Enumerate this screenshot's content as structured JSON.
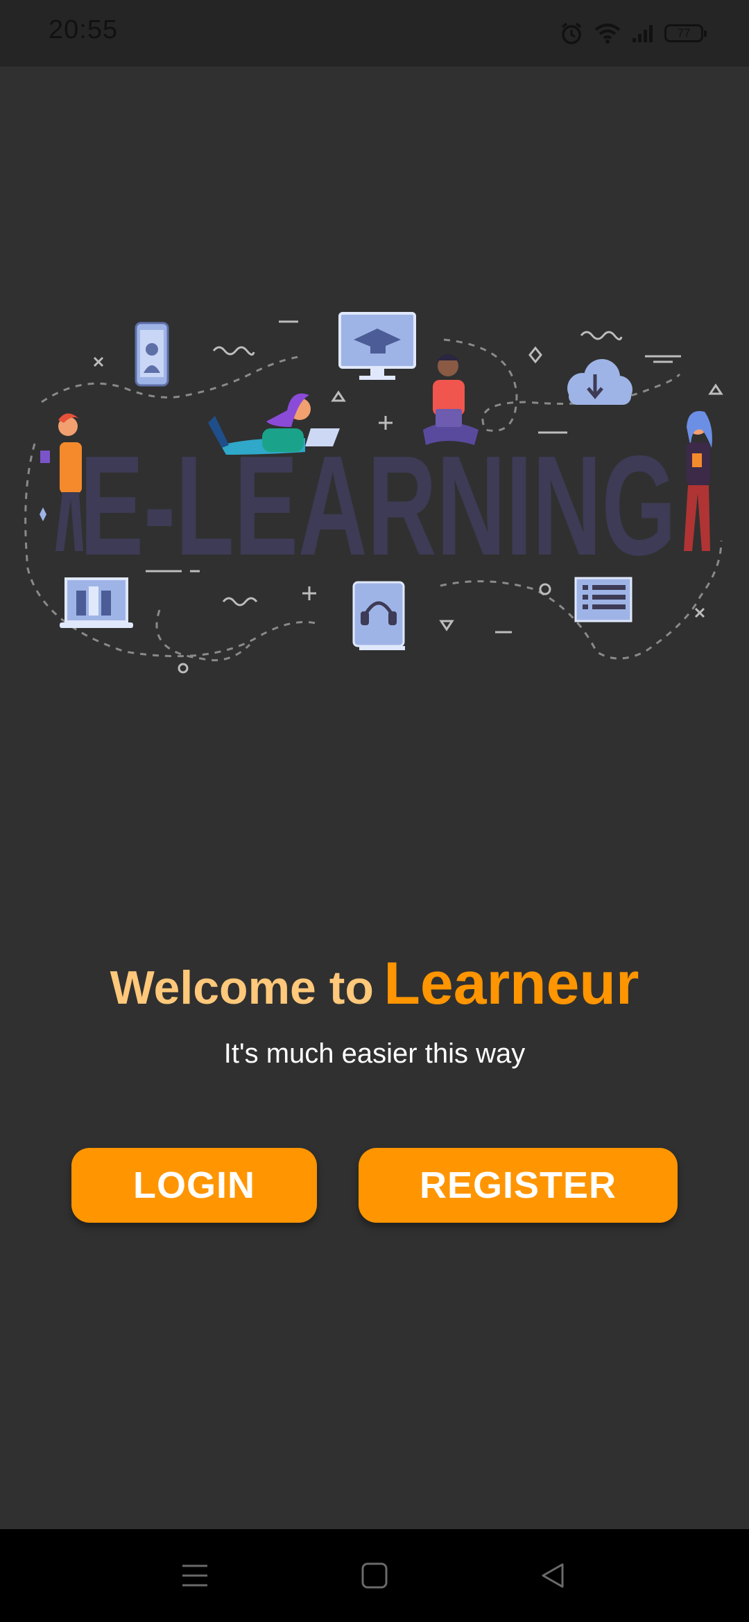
{
  "status_bar": {
    "time": "20:55",
    "battery_level": "77",
    "icons": [
      "alarm-icon",
      "wifi-icon",
      "signal-icon",
      "battery-icon"
    ]
  },
  "hero": {
    "illustration_text": "E-LEARNING"
  },
  "welcome": {
    "prefix": "Welcome to",
    "brand": "Learneur",
    "tagline": "It's much easier this way"
  },
  "buttons": {
    "login": "LOGIN",
    "register": "REGISTER"
  },
  "nav_bar": {
    "icons": [
      "menu-icon",
      "home-icon",
      "back-icon"
    ]
  },
  "colors": {
    "background": "#303030",
    "accent": "#ff9500",
    "welcome_text": "#ffc87a"
  }
}
